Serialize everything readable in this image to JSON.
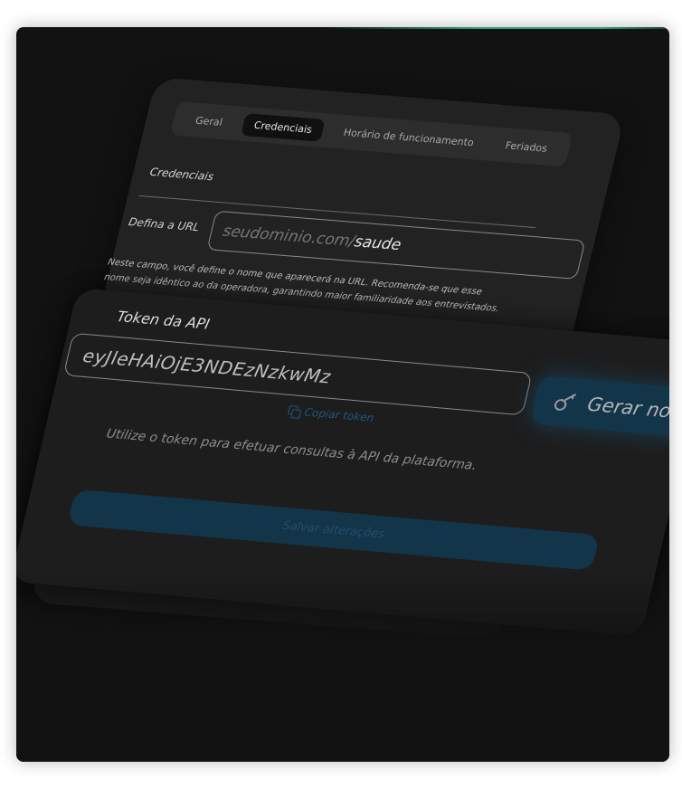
{
  "tabs": [
    {
      "label": "Geral",
      "active": false
    },
    {
      "label": "Credenciais",
      "active": true
    },
    {
      "label": "Horário de funcionamento",
      "active": false
    },
    {
      "label": "Feriados",
      "active": false
    }
  ],
  "credentials": {
    "section_title": "Credenciais",
    "url_label": "Defina a URL",
    "url_base": "seudominio.com/",
    "url_path": "saude",
    "help_text": "Neste campo, você define o nome que aparecerá na URL. Recomenda-se que esse nome seja idêntico ao da operadora, garantindo maior familiaridade aos entrevistados."
  },
  "token": {
    "label": "Token da API",
    "value": "eyJleHAiOjE3NDEzNzkwMz",
    "copy_label": "Copiar token",
    "generate_label": "Gerar novo",
    "hint": "Utilize o token para efetuar consultas à API da plataforma."
  },
  "actions": {
    "save_label": "Salvar alterações"
  },
  "colors": {
    "accent": "#2ea082",
    "button": "#13354a",
    "link": "#1e5a7e",
    "background": "#121212"
  },
  "icons": {
    "copy": "copy-icon",
    "key": "key-icon"
  }
}
